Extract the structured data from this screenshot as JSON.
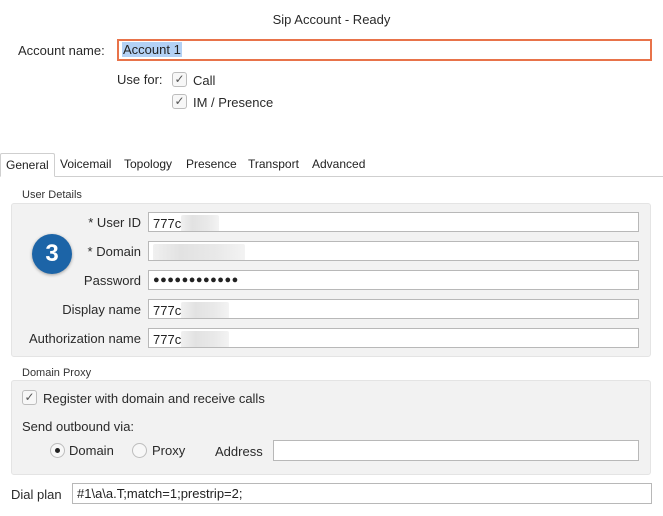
{
  "window": {
    "title": "Sip Account - Ready"
  },
  "account": {
    "name_label": "Account name:",
    "name_value": "Account 1",
    "use_for_label": "Use for:",
    "use_for": [
      {
        "label": "Call",
        "checked": true
      },
      {
        "label": "IM / Presence",
        "checked": true
      }
    ]
  },
  "tabs": [
    "General",
    "Voicemail",
    "Topology",
    "Presence",
    "Transport",
    "Advanced"
  ],
  "active_tab": "General",
  "user_details": {
    "section_title": "User Details",
    "badge": "3",
    "fields": [
      {
        "label": "* User ID",
        "value": "777c"
      },
      {
        "label": "* Domain",
        "value": ""
      },
      {
        "label": "Password",
        "value": "●●●●●●●●●●●●"
      },
      {
        "label": "Display name",
        "value": "777c"
      },
      {
        "label": "Authorization name",
        "value": "777c"
      }
    ]
  },
  "domain_proxy": {
    "section_title": "Domain Proxy",
    "register_label": "Register with domain and receive calls",
    "register_checked": true,
    "send_via_label": "Send outbound via:",
    "options": [
      {
        "label": "Domain",
        "selected": true
      },
      {
        "label": "Proxy",
        "selected": false
      }
    ],
    "address_label": "Address",
    "address_value": ""
  },
  "dial_plan": {
    "label": "Dial plan",
    "value": "#1\\a\\a.T;match=1;prestrip=2;"
  },
  "icons": {
    "check": "check-icon"
  },
  "colors": {
    "focus_border": "#e8734a",
    "badge": "#1c64a7",
    "selection": "#b3d1f5"
  }
}
